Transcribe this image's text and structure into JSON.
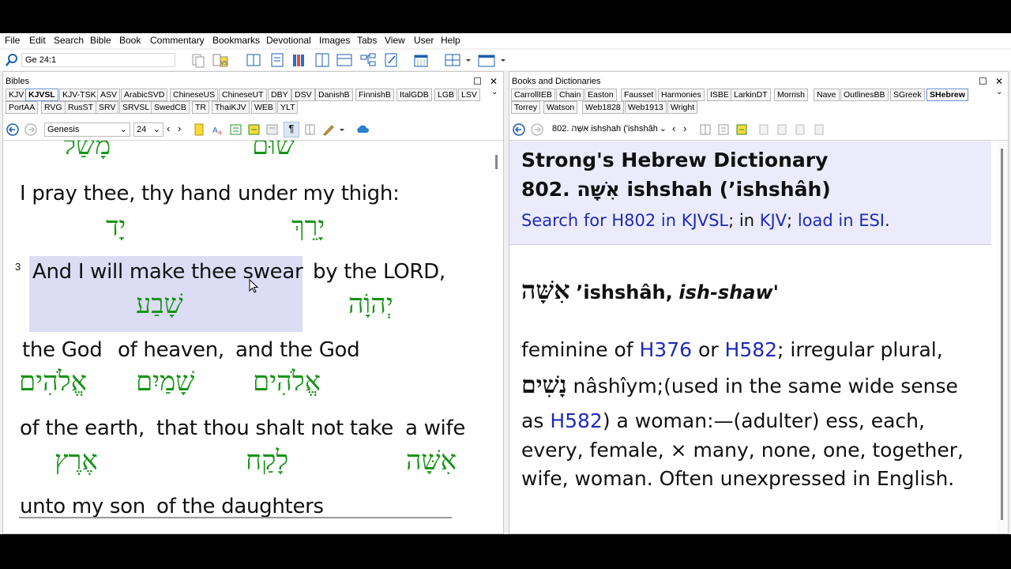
{
  "menu": [
    "File",
    "Edit",
    "Search",
    "Bible",
    "Book",
    "Commentary",
    "Bookmarks",
    "Devotional",
    "Images",
    "Tabs",
    "View",
    "User",
    "Help"
  ],
  "toolbar": {
    "reference_value": "Ge 24:1"
  },
  "bibles": {
    "title": "Bibles",
    "tabs_row1": [
      "KJV",
      "KJVSL",
      "KJV-TSK",
      "ASV",
      "ArabicSVD",
      "ChineseUS",
      "ChineseUT",
      "DBY",
      "DSV",
      "DanishB",
      "FinnishB",
      "ItalGDB",
      "LGB",
      "LSV"
    ],
    "tabs_row2": [
      "PortAA",
      "RVG",
      "RusST",
      "SRV",
      "SRVSL",
      "SwedCB",
      "TR",
      "ThaiKJV",
      "WEB",
      "YLT"
    ],
    "book": "Genesis",
    "chapter": "24",
    "text": {
      "l1_he_a": "מָשַׁל",
      "l1_he_b": "שׁוּם",
      "l2_en_a": "I pray thee, thy hand",
      "l2_en_b": "under my thigh:",
      "l2_he_a": "יָד",
      "l2_he_b": "יָרֵךְ",
      "verse_num": "3",
      "l3_en_a": "And I will make thee swear",
      "l3_en_b": "by the LORD,",
      "l3_he_a": "שָׁבַע",
      "l3_he_b": "יְהוָֹה",
      "l4_en_a": "the God",
      "l4_en_b": "of heaven,",
      "l4_en_c": "and the God",
      "l4_he_a": "אֱלֹהִים",
      "l4_he_b": "שָׁמַיִם",
      "l4_he_c": "אֱלֹהִים",
      "l5_en_a": "of the earth,",
      "l5_en_b": "that thou shalt not take",
      "l5_en_c": "a wife",
      "l5_he_a": "אֶרֶץ",
      "l5_he_b": "לָקַח",
      "l5_he_c": "אִשָּׁה",
      "l6_en_a": "unto my son",
      "l6_en_b": "of the daughters"
    }
  },
  "books": {
    "title": "Books and Dictionaries",
    "tabs_row1": [
      "CarrollIEB",
      "Chain",
      "Easton",
      "Fausset",
      "Harmonies",
      "ISBE",
      "LarkinDT",
      "Morrish",
      "Nave",
      "OutlinesBB",
      "SGreek",
      "SHebrew"
    ],
    "tabs_row2": [
      "Torrey",
      "Watson",
      "Web1828",
      "Web1913",
      "Wright"
    ],
    "entry_select": "802. אִשָּׁה ishshah ('ishshâh",
    "dict_title": "Strong's Hebrew Dictionary",
    "entry_heading": "802. אִשָּׁה ishshah (’ishshâh)",
    "search_link": "Search for H802 in KJVSL",
    "sep1": "; in",
    "kjv_link": "KJV",
    "sep2": ";",
    "esi_link": "load in ESI",
    "sep3": ".",
    "lemma_he": "אִשָּׁה",
    "lemma_translit": "’ishshâh,",
    "lemma_pron": "ish-shaw'",
    "def_a": "feminine of",
    "h376": "H376",
    "def_or": "or",
    "h582a": "H582",
    "def_b": "; irregular plural,",
    "plural_he": "נָשִׁים",
    "plural_translit": "nâshîym;(used in the same wide sense",
    "def_c": "as",
    "h582b": "H582",
    "def_d": ") a woman:—(adulter) ess, each,",
    "def_e": "every, female, × many, none, one, together,",
    "def_f": "wife, woman. Often unexpressed in English."
  },
  "colors": {
    "hebrew_green": "#179417",
    "link_blue": "#1f2bb5",
    "highlight": "#dcdcf5",
    "dict_header_bg": "#ebebfb"
  }
}
